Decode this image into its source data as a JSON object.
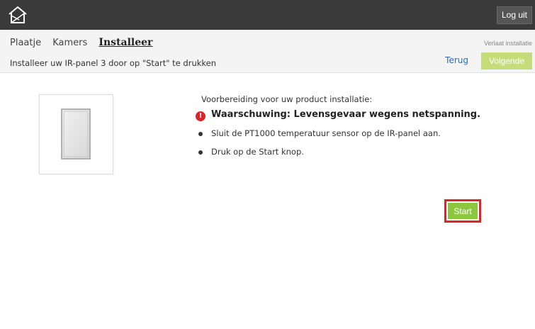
{
  "topbar": {
    "logo_icon": "house-logo-icon",
    "logout_label": "Log uit"
  },
  "subheader": {
    "tabs": [
      {
        "label": "Plaatje",
        "active": false
      },
      {
        "label": "Kamers",
        "active": false
      },
      {
        "label": "Installeer",
        "active": true
      }
    ],
    "exit_label": "Verlaat installatie",
    "instruction": "Installeer uw IR-panel 3 door op \"Start\" te drukken",
    "back_label": "Terug",
    "next_label": "Volgende"
  },
  "main": {
    "product_image_icon": "ir-panel-icon",
    "prep_title": "Voorbereiding voor uw product installatie:",
    "warning_icon": "exclamation-icon",
    "warning_text": "Waarschuwing: Levensgevaar wegens netspanning.",
    "steps": [
      "Sluit de PT1000 temperatuur sensor op de IR-panel aan.",
      "Druk op de Start knop."
    ],
    "start_label": "Start"
  },
  "colors": {
    "topbar": "#3a3a3a",
    "accent_green": "#8dc63f",
    "disabled_green": "#c4dd7a",
    "link_blue": "#2a6bb5",
    "warning_red": "#d9262a",
    "highlight_red": "#e0222a"
  }
}
